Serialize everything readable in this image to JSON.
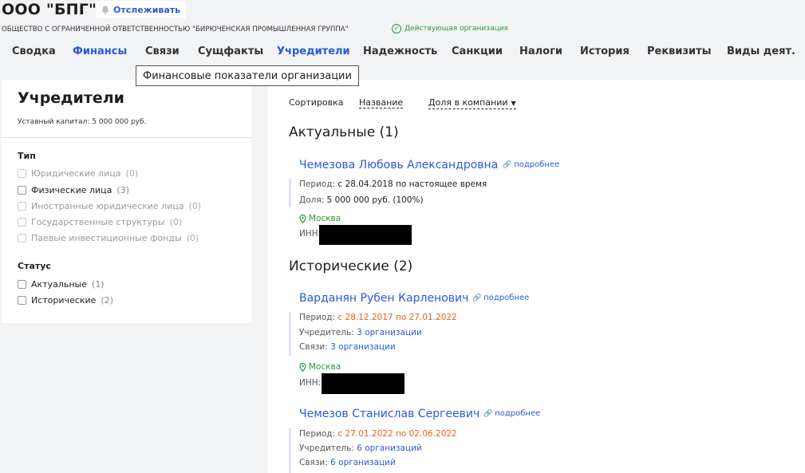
{
  "header": {
    "org_name": "ООО \"БПГ\"",
    "track_label": "Отслеживать",
    "full_name": "ОБЩЕСТВО С ОГРАНИЧЕННОЙ ОТВЕТСТВЕННОСТЬЮ \"БИРЮЧЕНСКАЯ ПРОМЫШЛЕННАЯ ГРУППА\"",
    "status": "Действующая организация"
  },
  "tabs": [
    {
      "label": "Сводка"
    },
    {
      "label": "Финансы"
    },
    {
      "label": "Связи"
    },
    {
      "label": "Сущфакты"
    },
    {
      "label": "Учредители"
    },
    {
      "label": "Надежность"
    },
    {
      "label": "Санкции"
    },
    {
      "label": "Налоги"
    },
    {
      "label": "История"
    },
    {
      "label": "Реквизиты"
    },
    {
      "label": "Виды деят."
    }
  ],
  "tooltip": "Финансовые показатели организации",
  "left": {
    "title": "Учредители",
    "capital": "Уставный капитал: 5 000 000 руб.",
    "type_title": "Тип",
    "types": [
      {
        "label": "Юридические лица",
        "count": "(0)"
      },
      {
        "label": "Физические лица",
        "count": "(3)"
      },
      {
        "label": "Иностранные юридические лица",
        "count": "(0)"
      },
      {
        "label": "Государственные структуры",
        "count": "(0)"
      },
      {
        "label": "Паевые инвестиционные фонды",
        "count": "(0)"
      }
    ],
    "status_title": "Статус",
    "statuses": [
      {
        "label": "Актуальные",
        "count": "(1)"
      },
      {
        "label": "Исторические",
        "count": "(2)"
      }
    ]
  },
  "main": {
    "sort_label": "Сортировка",
    "sort_name": "Название",
    "sort_share": "Доля в компании",
    "current_title": "Актуальные (1)",
    "historical_title": "Исторические (2)",
    "more_label": "подробнее",
    "people": [
      {
        "name": "Чемезова Любовь Александровна",
        "period_label": "Период:",
        "period": "с 28.04.2018 по настоящее время",
        "share_label": "Доля:",
        "share": "5 000 000 руб. (100%)",
        "city": "Москва",
        "inn_label": "ИНН:"
      },
      {
        "name": "Варданян Рубен Карленович",
        "period_label": "Период:",
        "period": "с 28.12.2017 по 27.01.2022",
        "founder_label": "Учредитель:",
        "founder": "3 организации",
        "links_label": "Связи:",
        "links": "3 организации",
        "city": "Москва",
        "inn_label": "ИНН:"
      },
      {
        "name": "Чемезов Станислав Сергеевич",
        "period_label": "Период:",
        "period": "с 27.01.2022 по 02.06.2022",
        "founder_label": "Учредитель:",
        "founder": "6 организаций",
        "links_label": "Связи:",
        "links": "6 организаций"
      }
    ]
  },
  "colors": {
    "accent": "#2a5bd7",
    "success": "#2b9a3e",
    "warning": "#e8601c"
  }
}
